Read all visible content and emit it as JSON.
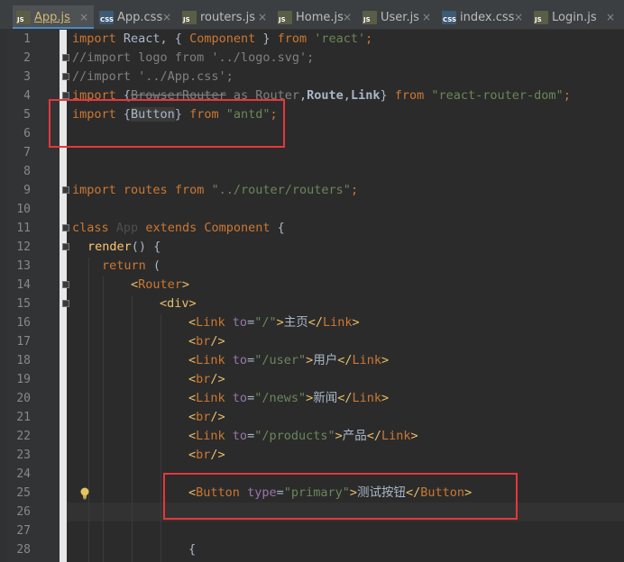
{
  "tabs": [
    {
      "icon": "js-file-icon",
      "icon_text": "JS",
      "label": "App.js",
      "active": true
    },
    {
      "icon": "css-file-icon",
      "icon_text": "CSS",
      "label": "App.css",
      "active": false
    },
    {
      "icon": "js-file-icon",
      "icon_text": "JS",
      "label": "routers.js",
      "active": false
    },
    {
      "icon": "js-file-icon",
      "icon_text": "JS",
      "label": "Home.js",
      "active": false
    },
    {
      "icon": "js-file-icon",
      "icon_text": "JS",
      "label": "User.js",
      "active": false
    },
    {
      "icon": "css-file-icon",
      "icon_text": "CSS",
      "label": "index.css",
      "active": false
    },
    {
      "icon": "js-file-icon",
      "icon_text": "JS",
      "label": "Login.js",
      "active": false
    }
  ],
  "close_glyph": "×",
  "line_numbers": [
    "1",
    "2",
    "3",
    "4",
    "5",
    "6",
    "7",
    "8",
    "9",
    "10",
    "11",
    "12",
    "13",
    "14",
    "15",
    "16",
    "17",
    "18",
    "19",
    "20",
    "21",
    "22",
    "23",
    "24",
    "25",
    "26",
    "27",
    "28"
  ],
  "code": {
    "l1": {
      "a": "import",
      "b": " React, { ",
      "c": "Component",
      "d": " } ",
      "e": "from",
      "f": " ",
      "g": "'react'",
      "h": ";"
    },
    "l2": {
      "a": "//import logo from '../logo.svg';"
    },
    "l3": {
      "a": "//import '../App.css';"
    },
    "l4": {
      "a": "import",
      "b": " {",
      "c": "BrowserRouter",
      "d": " as ",
      "e": "Router",
      "f": ",",
      "g": "Route",
      "h": ",",
      "i": "Link",
      "j": "} ",
      "k": "from",
      "l": " ",
      "m": "\"react-router-dom\"",
      "n": ";"
    },
    "l5": {
      "a": "import",
      "b": " {",
      "c": "Button",
      "d": "} ",
      "e": "from",
      "f": " ",
      "g": "\"antd\"",
      "h": ";"
    },
    "l9": {
      "a": "import",
      "b": " ",
      "c": "routes",
      "d": " ",
      "e": "from",
      "f": " ",
      "g": "\"../router/routers\"",
      "h": ";"
    },
    "l11": {
      "a": "class",
      "b": " ",
      "c": "App",
      "d": " ",
      "e": "extends",
      "f": " ",
      "g": "Component",
      "h": " {"
    },
    "l12": {
      "a": "render",
      "b": "() {"
    },
    "l13": {
      "a": "return",
      "b": " ("
    },
    "l14": {
      "a": "<",
      "b": "Router",
      ">": ">"
    },
    "l15": {
      "a": "<",
      "b": "div",
      ">": ">"
    },
    "l16": {
      "open": "<",
      "tag": "Link",
      "sp": " ",
      "attr": "to",
      "eq": "=",
      "val": "\"/\"",
      "gt": ">",
      "text": "主页",
      "close": "</",
      "ctag": "Link",
      "cgt": ">"
    },
    "l17": {
      "a": "<",
      "b": "br",
      "c": "/>"
    },
    "l18": {
      "open": "<",
      "tag": "Link",
      "sp": " ",
      "attr": "to",
      "eq": "=",
      "val": "\"/user\"",
      "gt": ">",
      "text": "用户",
      "close": "</",
      "ctag": "Link",
      "cgt": ">"
    },
    "l19": {
      "a": "<",
      "b": "br",
      "c": "/>"
    },
    "l20": {
      "open": "<",
      "tag": "Link",
      "sp": " ",
      "attr": "to",
      "eq": "=",
      "val": "\"/news\"",
      "gt": ">",
      "text": "新闻",
      "close": "</",
      "ctag": "Link",
      "cgt": ">"
    },
    "l21": {
      "a": "<",
      "b": "br",
      "c": "/>"
    },
    "l22": {
      "open": "<",
      "tag": "Link",
      "sp": " ",
      "attr": "to",
      "eq": "=",
      "val": "\"/products\"",
      "gt": ">",
      "text": "产品",
      "close": "</",
      "ctag": "Link",
      "cgt": ">"
    },
    "l23": {
      "a": "<",
      "b": "br",
      "c": "/>"
    },
    "l25": {
      "open": "<",
      "tag": "Button",
      "sp": " ",
      "attr": "type",
      "eq": "=",
      "val": "\"primary\"",
      "gt": ">",
      "text": "测试按钮",
      "close": "</",
      "ctag": "Button",
      "cgt": ">"
    },
    "l28": {
      "a": "{"
    }
  },
  "colors": {
    "highlight_box": "#e8363c",
    "active_tab_text": "#d6b870",
    "keyword": "#cc7832",
    "string": "#6a8759",
    "tag": "#e8bf6a"
  }
}
